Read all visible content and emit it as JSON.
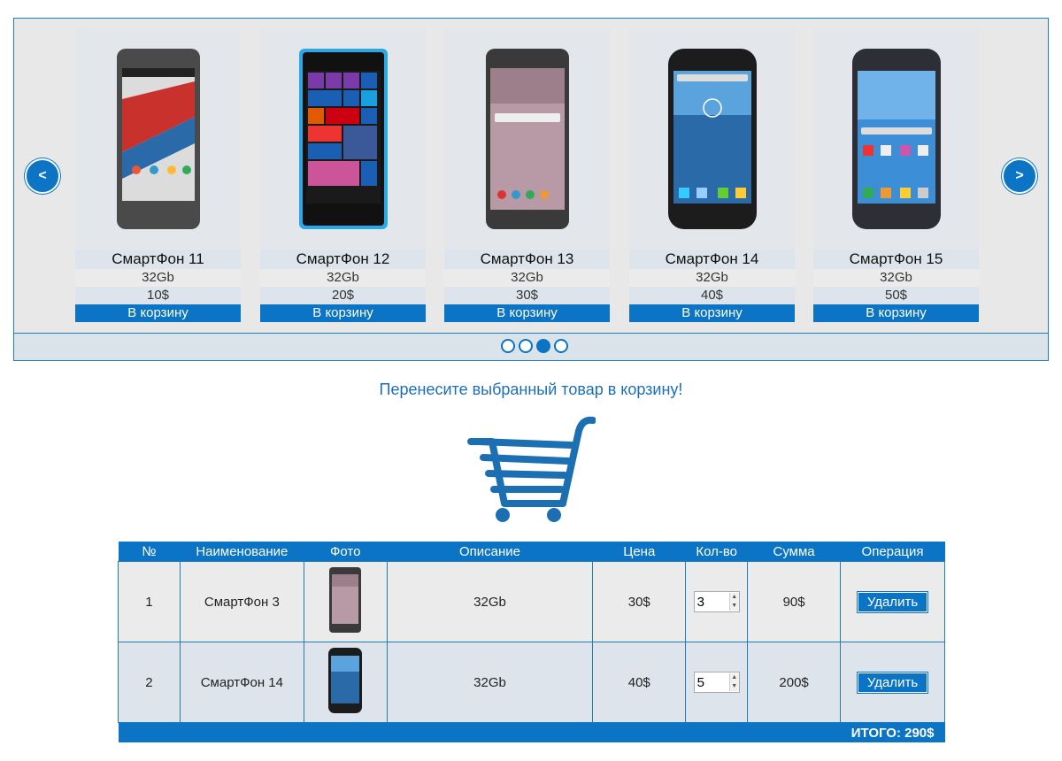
{
  "carousel": {
    "prev_label": "<",
    "next_label": ">",
    "products": [
      {
        "name": "СмартФон 11",
        "memory": "32Gb",
        "price": "10$",
        "buy_label": "В корзину",
        "screen_color": "#c9312c",
        "body_color": "#4a4a4a"
      },
      {
        "name": "СмартФон 12",
        "memory": "32Gb",
        "price": "20$",
        "buy_label": "В корзину",
        "screen_color": "#1a5fb4",
        "body_color": "#2aa9e8"
      },
      {
        "name": "СмартФон 13",
        "memory": "32Gb",
        "price": "30$",
        "buy_label": "В корзину",
        "screen_color": "#b89aa6",
        "body_color": "#3a3a3a"
      },
      {
        "name": "СмартФон 14",
        "memory": "32Gb",
        "price": "40$",
        "buy_label": "В корзину",
        "screen_color": "#2b6aa8",
        "body_color": "#1c1c1c"
      },
      {
        "name": "СмартФон 15",
        "memory": "32Gb",
        "price": "50$",
        "buy_label": "В корзину",
        "screen_color": "#3c8ed6",
        "body_color": "#2e2e36"
      }
    ],
    "dots_total": 4,
    "dots_active": 3
  },
  "hint": "Перенесите выбранный товар в корзину!",
  "cart_icon": "shopping-cart-icon",
  "cart": {
    "headers": [
      "№",
      "Наименование",
      "Фото",
      "Описание",
      "Цена",
      "Кол-во",
      "Сумма",
      "Операция"
    ],
    "rows": [
      {
        "num": "1",
        "name": "СмартФон 3",
        "desc": "32Gb",
        "price": "30$",
        "qty": "3",
        "sum": "90$",
        "delete_label": "Удалить",
        "screen_color": "#b89aa6",
        "body_color": "#3a3a3a"
      },
      {
        "num": "2",
        "name": "СмартФон 14",
        "desc": "32Gb",
        "price": "40$",
        "qty": "5",
        "sum": "200$",
        "delete_label": "Удалить",
        "screen_color": "#2b6aa8",
        "body_color": "#1c1c1c"
      }
    ],
    "total": "ИТОГО: 290$"
  },
  "colors": {
    "accent": "#0b74c4",
    "hint_text": "#1d6fb3"
  }
}
